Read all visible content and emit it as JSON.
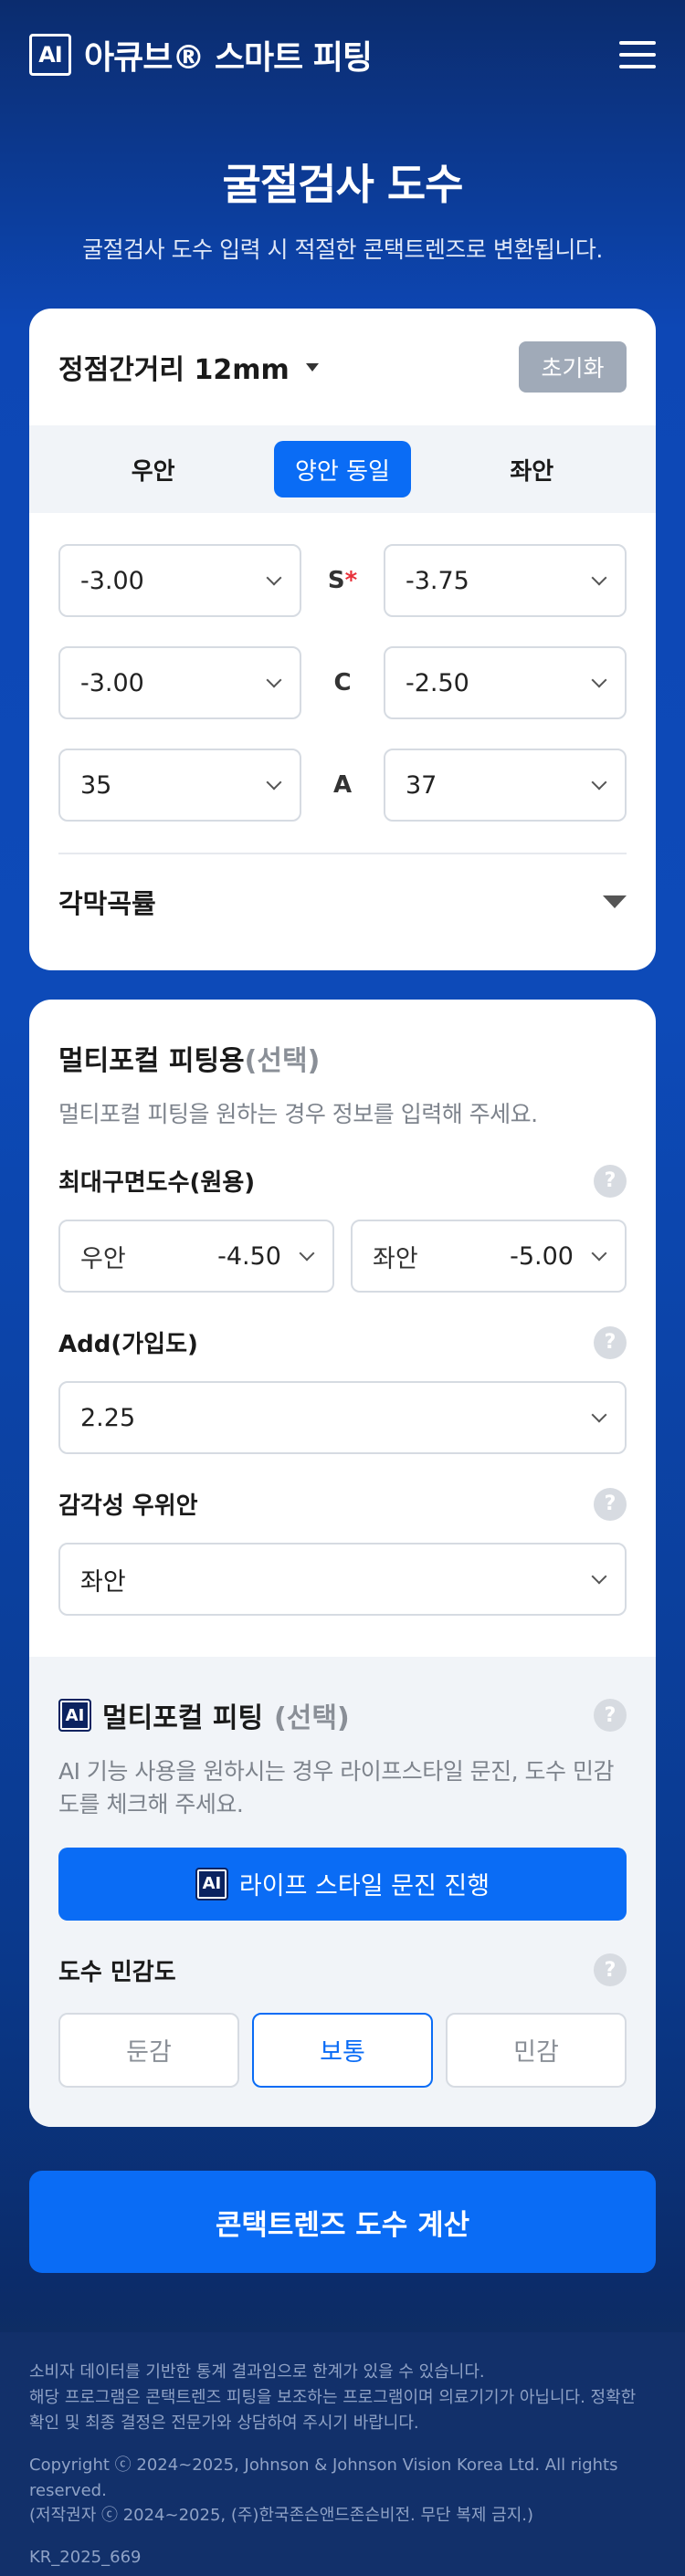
{
  "header": {
    "logo_text": "AI",
    "brand_title": "아큐브® 스마트 피팅"
  },
  "hero": {
    "title": "굴절검사 도수",
    "subtitle": "굴절검사 도수 입력 시 적절한 콘택트렌즈로 변환됩니다."
  },
  "refraction": {
    "vertex_label": "정점간거리 12mm",
    "reset_label": "초기화",
    "tabs": [
      "우안",
      "양안 동일",
      "좌안"
    ],
    "active_tab": "양안 동일",
    "rows": [
      {
        "label": "S",
        "required_mark": "*",
        "right": "-3.00",
        "left": "-3.75"
      },
      {
        "label": "C",
        "required_mark": "",
        "right": "-3.00",
        "left": "-2.50"
      },
      {
        "label": "A",
        "required_mark": "",
        "right": "35",
        "left": "37"
      }
    ],
    "keratometry_label": "각막곡률"
  },
  "multifocal": {
    "title": "멀티포컬 피팅용",
    "title_optional": "(선택)",
    "description": "멀티포컬 피팅을 원하는 경우 정보를 입력해 주세요.",
    "max_plus_label": "최대구면도수(원용)",
    "right_label": "우안",
    "right_value": "-4.50",
    "left_label": "좌안",
    "left_value": "-5.00",
    "add_label": "Add(가입도)",
    "add_value": "2.25",
    "dominant_label": "감각성 우위안",
    "dominant_value": "좌안"
  },
  "ai_fitting": {
    "title": "멀티포컬 피팅",
    "title_optional": "(선택)",
    "description": "AI 기능 사용을 원하시는 경우 라이프스타일 문진, 도수 민감도를 체크해 주세요.",
    "button_label": "라이프 스타일 문진 진행",
    "sensitivity_label": "도수 민감도",
    "sensitivity_options": [
      "둔감",
      "보통",
      "민감"
    ],
    "sensitivity_selected": "보통"
  },
  "calc_button_label": "콘택트렌즈 도수 계산",
  "footer": {
    "line1": "소비자 데이터를 기반한 통계 결과임으로 한계가 있을 수 있습니다.",
    "line2": "해당 프로그램은 콘택트렌즈 피팅을 보조하는 프로그램이며 의료기기가 아닙니다. 정확한 확인 및 최종 결정은 전문가와 상담하여 주시기 바랍니다.",
    "copyright1": "Copyright ⓒ 2024~2025, Johnson & Johnson Vision Korea Ltd. All rights reserved.",
    "copyright2": "(저작권자 ⓒ 2024~2025, (주)한국존슨앤드존슨비전. 무단 복제 금지.)",
    "code": "KR_2025_669"
  },
  "colors": {
    "primary": "#0a6cf5",
    "header_bg": "#0b2c6e",
    "footer_bg": "#12306a",
    "required": "#e8313a"
  },
  "icons": {
    "menu": "hamburger-menu-icon",
    "help": "question-icon",
    "dropdown": "chevron-down-icon"
  }
}
